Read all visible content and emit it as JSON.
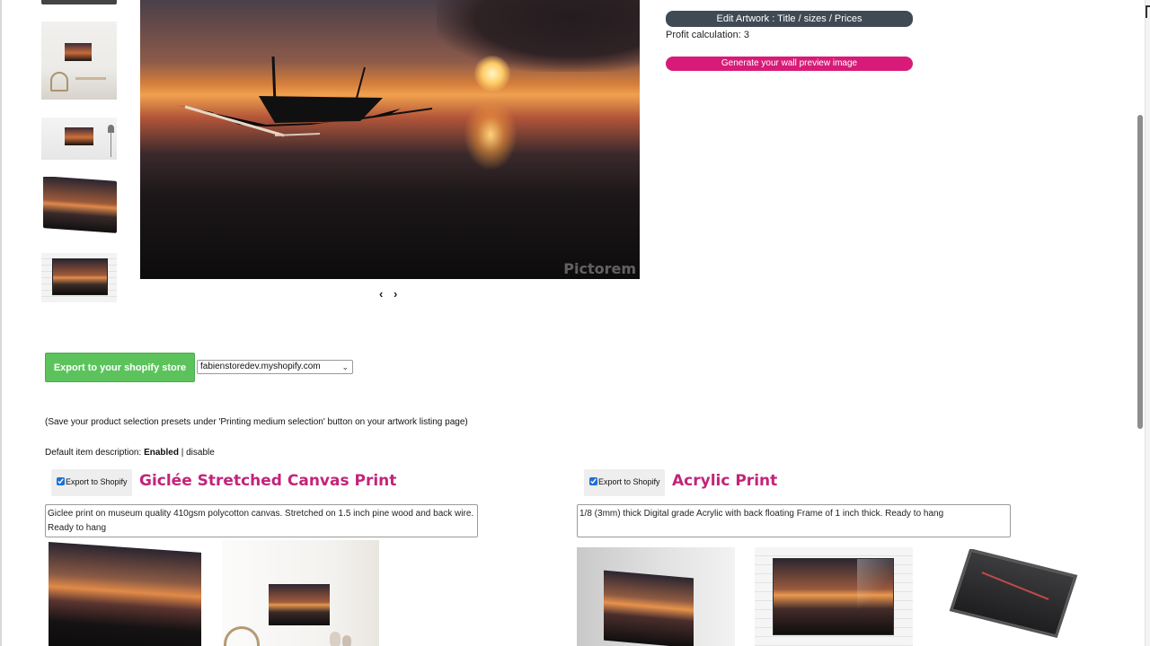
{
  "gallery": {
    "main_image_watermark": "Pictorem",
    "nav_arrows": "‹ ›"
  },
  "actions": {
    "edit_artwork_label": "Edit Artwork : Title / sizes / Prices",
    "profit_calculation": "Profit calculation: 3",
    "generate_preview_label": "Generate your wall preview image"
  },
  "export": {
    "button_label": "Export to your shopify store",
    "store_selected": "fabienstoredev.myshopify.com"
  },
  "note": "(Save your product selection presets under 'Printing medium selection' button on your artwork listing page)",
  "default_description": {
    "label": "Default item description: ",
    "status": "Enabled",
    "separator": " | ",
    "toggle_link": "disable"
  },
  "products": [
    {
      "export_checkbox_label": "Export to Shopify",
      "checked": true,
      "title": "Giclée Stretched Canvas Print",
      "description": "Giclee print on museum quality 410gsm polycotton canvas. Stretched on 1.5 inch pine wood and back wire. Ready to hang"
    },
    {
      "export_checkbox_label": "Export to Shopify",
      "checked": true,
      "title": "Acrylic Print",
      "description": "1/8 (3mm) thick Digital grade Acrylic with back floating Frame of 1 inch thick. Ready to hang"
    }
  ],
  "colors": {
    "brand_pink": "#d81b78",
    "title_pink": "#c2247a",
    "export_green": "#5cc35c",
    "dark_button": "#3f4a55"
  }
}
